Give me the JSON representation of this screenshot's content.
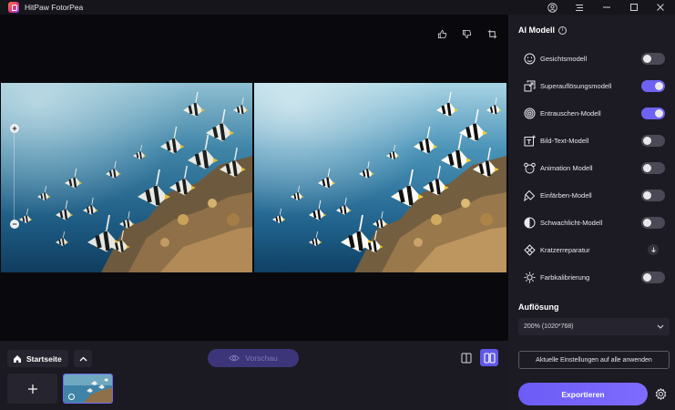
{
  "app": {
    "title": "HitPaw FotorPea"
  },
  "ai_panel": {
    "title": "AI Modell",
    "models": [
      {
        "label": "Gesichtsmodell",
        "icon": "face-icon",
        "control": "toggle",
        "enabled": false
      },
      {
        "label": "Superauflösungsmodell",
        "icon": "upscale-icon",
        "control": "toggle",
        "enabled": true
      },
      {
        "label": "Entrauschen-Modell",
        "icon": "denoise-icon",
        "control": "toggle",
        "enabled": true
      },
      {
        "label": "Bild-Text-Modell",
        "icon": "image-text-icon",
        "control": "toggle",
        "enabled": false
      },
      {
        "label": "Animation Modell",
        "icon": "animation-icon",
        "control": "toggle",
        "enabled": false
      },
      {
        "label": "Einfärben-Modell",
        "icon": "colorize-icon",
        "control": "toggle",
        "enabled": false
      },
      {
        "label": "Schwachlicht-Modell",
        "icon": "lowlight-icon",
        "control": "toggle",
        "enabled": false
      },
      {
        "label": "Kratzerreparatur",
        "icon": "scratch-repair-icon",
        "control": "download",
        "enabled": false
      },
      {
        "label": "Farbkalibrierung",
        "icon": "color-calibration-icon",
        "control": "toggle",
        "enabled": false
      }
    ]
  },
  "resolution": {
    "title": "Auflösung",
    "selected": "200% (1020*768)"
  },
  "actions": {
    "apply_all": "Aktuelle Einstellungen auf alle anwenden",
    "export": "Exportieren"
  },
  "bottom": {
    "home": "Startseite",
    "preview": "Vorschau"
  },
  "zoom": {
    "plus": "+",
    "minus": "−"
  },
  "colors": {
    "accent": "#6d62f2",
    "panel_bg": "#1c1b24",
    "canvas_bg": "#09090d"
  }
}
